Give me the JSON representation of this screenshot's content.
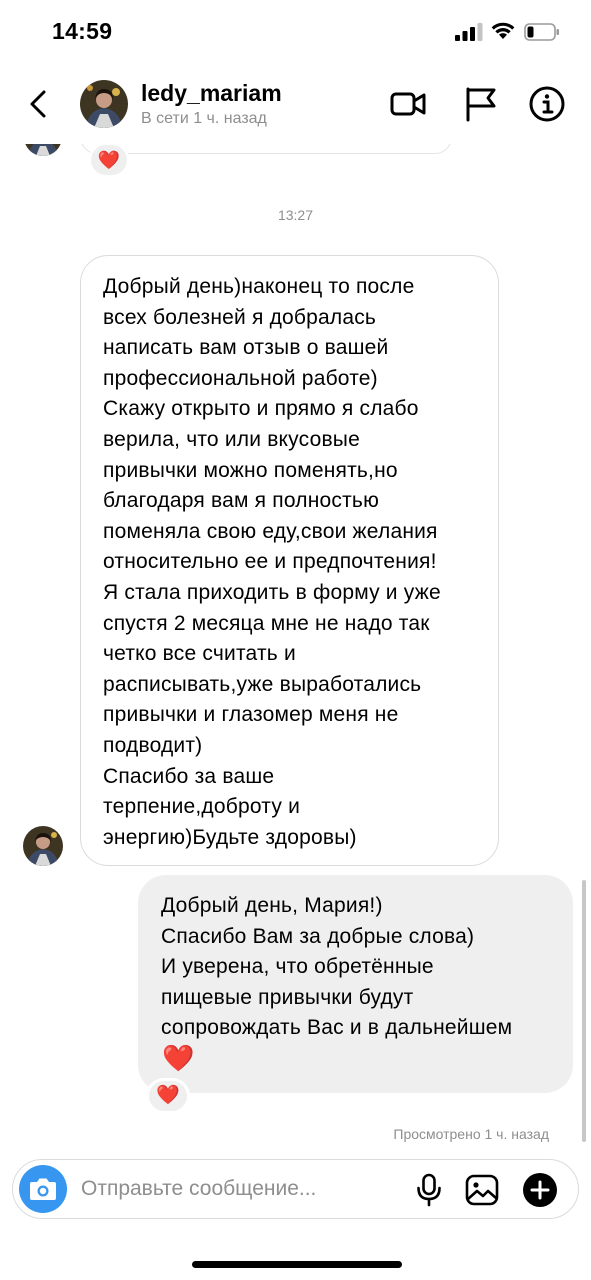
{
  "status_bar": {
    "time": "14:59"
  },
  "header": {
    "username": "ledy_mariam",
    "status": "В сети 1 ч. назад",
    "icons": [
      "back-icon",
      "video-call-icon",
      "flag-icon",
      "info-icon"
    ]
  },
  "thread": {
    "previous_reaction": "❤️",
    "timestamp": "13:27",
    "incoming_message": "Добрый день)наконец то после\nвсех болезней я добралась\nнаписать вам отзыв о вашей\nпрофессиональной работе)\nСкажу открыто и прямо я слабо\nверила, что или вкусовые\nпривычки можно поменять,но\nблагодаря вам я полностью\nпоменяла свою еду,свои желания\nотносительно ее и предпочтения!\nЯ стала приходить в форму и уже\nспустя 2 месяца мне не надо так\nчетко все считать и\nрасписывать,уже выработались\nпривычки и глазомер меня не\nподводит)\nСпасибо за ваше\nтерпение,доброту и\nэнергию)Будьте здоровы)",
    "outgoing_message": "Добрый день, Мария!)\nСпасибо Вам за добрые слова)\nИ уверена, что обретённые\nпищевые привычки будут\nсопровождать Вас и в дальнейшем",
    "outgoing_emoji": "❤️",
    "outgoing_reaction": "❤️",
    "seen_label": "Просмотрено 1 ч. назад"
  },
  "composer": {
    "placeholder": "Отправьте сообщение...",
    "value": "",
    "icons": [
      "camera-icon",
      "microphone-icon",
      "gallery-icon",
      "plus-icon"
    ]
  },
  "colors": {
    "accent": "#3797f0",
    "heart": "#ed1c3c",
    "outgoing_bubble": "#efefef",
    "secondary_text": "#8e8e8e"
  }
}
